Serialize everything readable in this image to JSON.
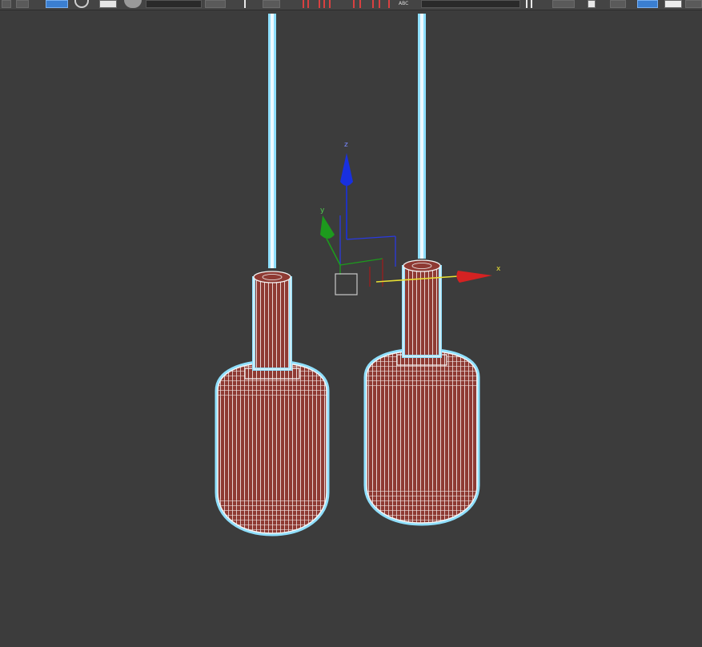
{
  "toolbar": {
    "abc_label": "ABC",
    "accent_color": "#3b7fd1"
  },
  "viewport": {
    "background_color": "#3c3c3c",
    "selection_outline_color": "#8fe0ff",
    "mesh_color": "#8e3a33"
  },
  "gizmo": {
    "x_label": "x",
    "y_label": "y",
    "z_label": "z",
    "x_color": "#d42222",
    "y_color": "#1d9a1d",
    "z_color": "#1830e0"
  }
}
